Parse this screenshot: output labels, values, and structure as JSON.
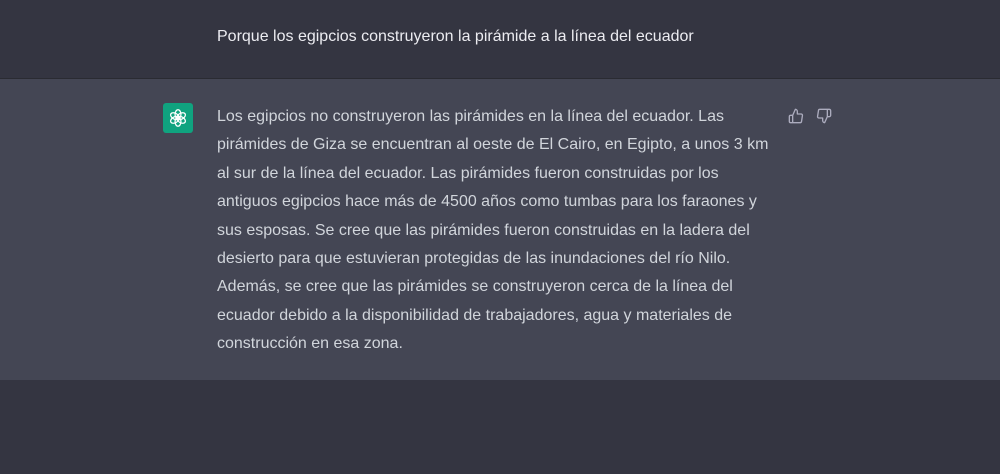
{
  "conversation": {
    "user_message": "Porque los egipcios construyeron la pirámide a la línea del ecuador",
    "assistant_message": "Los egipcios no construyeron las pirámides en la línea del ecuador. Las pirámides de Giza se encuentran al oeste de El Cairo, en Egipto, a unos 3 km al sur de la línea del ecuador. Las pirámides fueron construidas por los antiguos egipcios hace más de 4500 años como tumbas para los faraones y sus esposas. Se cree que las pirámides fueron construidas en la ladera del desierto para que estuvieran protegidas de las inundaciones del río Nilo. Además, se cree que las pirámides se construyeron cerca de la línea del ecuador debido a la disponibilidad de trabajadores, agua y materiales de construcción en esa zona."
  },
  "icons": {
    "avatar": "openai-logo-icon",
    "thumb_up": "thumbs-up-icon",
    "thumb_down": "thumbs-down-icon"
  },
  "colors": {
    "background": "#343541",
    "assistant_background": "#444654",
    "avatar_background": "#10a37f",
    "text": "#d1d5db"
  }
}
